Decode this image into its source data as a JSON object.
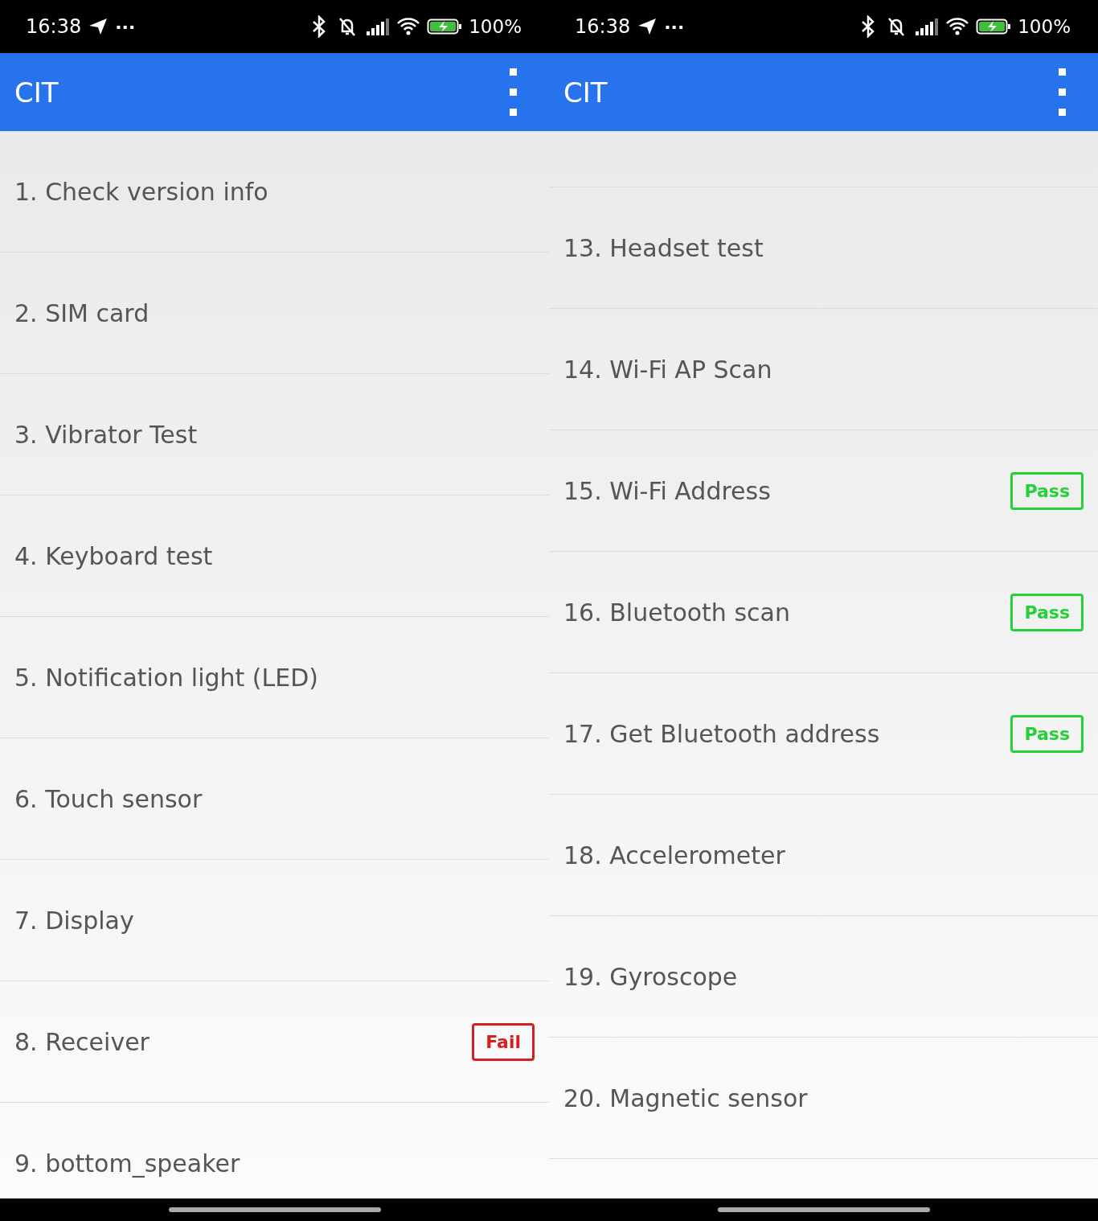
{
  "panes": [
    {
      "status_bar": {
        "time": "16:38",
        "more": "···",
        "battery": "100%"
      },
      "title": "CIT",
      "scrolled": false,
      "items": [
        {
          "label": "1. Check version info"
        },
        {
          "label": "2. SIM card"
        },
        {
          "label": "3. Vibrator Test"
        },
        {
          "label": "4. Keyboard test"
        },
        {
          "label": "5. Notification light (LED)"
        },
        {
          "label": "6. Touch sensor"
        },
        {
          "label": "7. Display"
        },
        {
          "label": "8. Receiver",
          "result": {
            "kind": "fail",
            "text": "Fail"
          }
        },
        {
          "label": "9. bottom_speaker"
        }
      ]
    },
    {
      "status_bar": {
        "time": "16:38",
        "more": "···",
        "battery": "100%"
      },
      "title": "CIT",
      "scrolled": true,
      "items": [
        {
          "label": "13. Headset test"
        },
        {
          "label": "14. Wi-Fi AP Scan"
        },
        {
          "label": "15. Wi-Fi Address",
          "result": {
            "kind": "pass",
            "text": "Pass"
          }
        },
        {
          "label": "16. Bluetooth scan",
          "result": {
            "kind": "pass",
            "text": "Pass"
          }
        },
        {
          "label": "17. Get Bluetooth address",
          "result": {
            "kind": "pass",
            "text": "Pass"
          }
        },
        {
          "label": "18. Accelerometer"
        },
        {
          "label": "19. Gyroscope"
        },
        {
          "label": "20. Magnetic sensor"
        }
      ]
    }
  ]
}
